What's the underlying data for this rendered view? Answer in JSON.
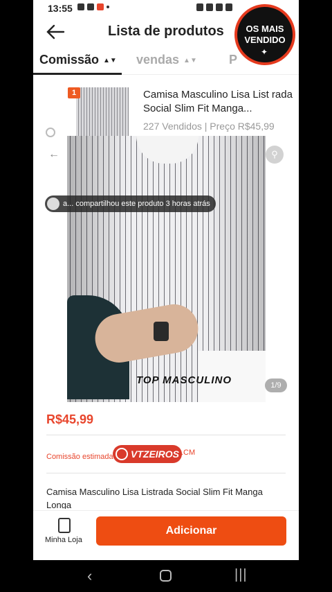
{
  "status": {
    "time": "13:55"
  },
  "header": {
    "title": "Lista de produtos"
  },
  "tabs": [
    {
      "label": "Comissão"
    },
    {
      "label": "vendas"
    },
    {
      "label": "P"
    }
  ],
  "badge": {
    "line1": "OS MAIS",
    "line2": "VENDIDO"
  },
  "card": {
    "rank": "1",
    "title": "Camisa Masculino Lisa List rada Social Slim Fit Manga...",
    "sold": "227 Vendidos",
    "price_label": "Preço R$45,99"
  },
  "viewer": {
    "share_text": "a... compartilhou este produto 3 horas atrás",
    "watermark": "TOP MASCULINO",
    "counter": "1/9"
  },
  "detail": {
    "price": "R$45,99",
    "commission_label": "Comissão estimada",
    "logo_text": "VTZEIROS",
    "logo_suffix": ".CM",
    "title": "Camisa Masculino Lisa Listrada Social Slim Fit Manga Longa"
  },
  "bottom": {
    "store_label": "Minha Loja",
    "add_label": "Adicionar"
  },
  "colors": {
    "accent": "#ee4d12",
    "price": "#e8452c"
  }
}
